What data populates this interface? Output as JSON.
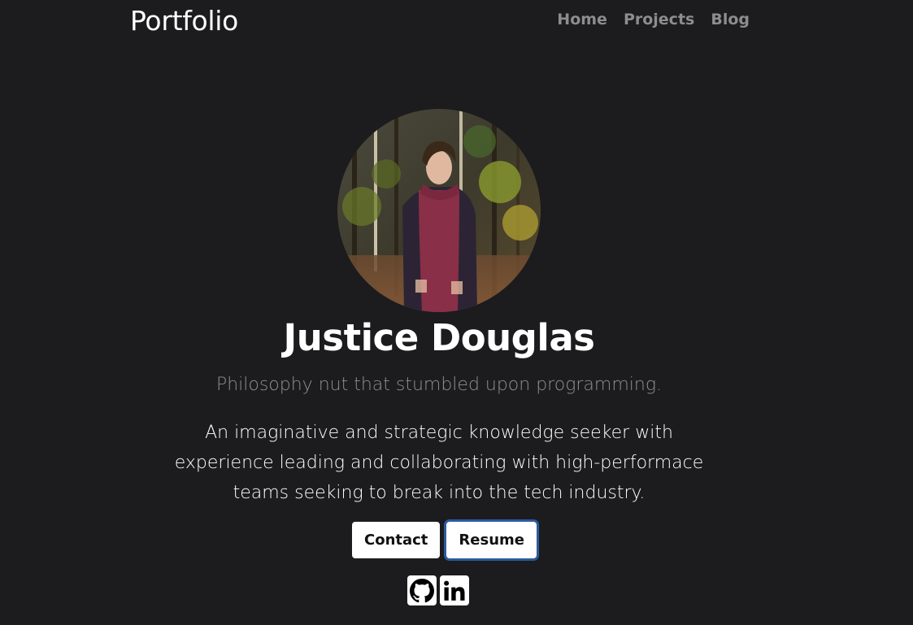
{
  "nav": {
    "brand": "Portfolio",
    "links": [
      "Home",
      "Projects",
      "Blog"
    ]
  },
  "hero": {
    "name": "Justice Douglas",
    "tagline": "Philosophy nut that stumbled upon programming.",
    "bio": "An imaginative and strategic knowledge seeker with experience leading and collaborating with high-performace teams seeking to break into the tech industry.",
    "buttons": {
      "contact": "Contact",
      "resume": "Resume"
    },
    "socials": [
      "github-icon",
      "linkedin-icon"
    ]
  },
  "colors": {
    "background": "#1c1b1d",
    "nav_link": "#8d8c8e",
    "tagline": "#8f8e90",
    "focus_ring": "#2b5aa0"
  }
}
